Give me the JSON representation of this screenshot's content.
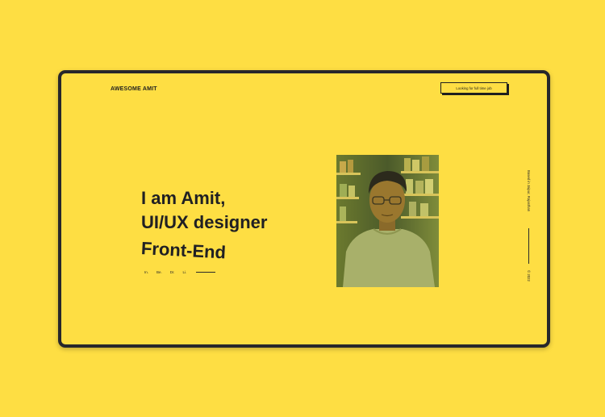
{
  "header": {
    "brand": "AWESOME AMIT",
    "job_button_label": "Looking for full time job"
  },
  "hero": {
    "line1": "I am Amit,",
    "line2": "UI/UX designer",
    "line3": "Front-End"
  },
  "socials": {
    "items": [
      "In.",
      "Be.",
      "Dr.",
      "Li."
    ]
  },
  "side": {
    "location": "Based in Jaipur, Rajasthan",
    "copyright": "© 2022"
  },
  "colors": {
    "background": "#fede43",
    "frame_border": "#27272b",
    "text": "#202023"
  },
  "photo": {
    "icon": "portrait-photo"
  }
}
